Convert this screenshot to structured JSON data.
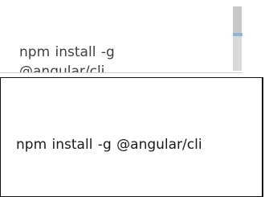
{
  "narrow_textarea": {
    "line1": "npm install -g",
    "line2": "@angular/cli"
  },
  "wide_textarea": {
    "value": "npm install -g @angular/cli"
  },
  "colors": {
    "text_gray": "#404040",
    "text_dark": "#1a1a1a",
    "scrollbar": "#d9d9d9",
    "scroll_accent": "#8fb6d6",
    "border": "#111111"
  }
}
